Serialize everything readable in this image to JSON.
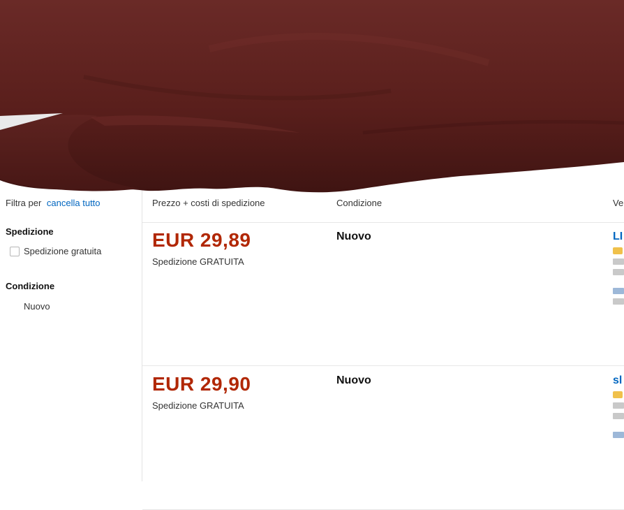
{
  "sidebar": {
    "filter_label": "Filtra per",
    "filter_link": "cancella tutto",
    "facets": [
      {
        "heading": "Spedizione",
        "option": "Spedizione gratuita"
      },
      {
        "heading": "Condizione",
        "option": "Nuovo"
      }
    ]
  },
  "table": {
    "columns": {
      "price": "Prezzo + costi di spedizione",
      "condition": "Condizione",
      "seller": "Ve"
    }
  },
  "offers": [
    {
      "price": "EUR 29,89",
      "shipping": "Spedizione GRATUITA",
      "condition": "Nuovo",
      "seller": "LI"
    },
    {
      "price": "EUR 29,90",
      "shipping": "Spedizione GRATUITA",
      "condition": "Nuovo",
      "seller": "sl"
    }
  ],
  "colors": {
    "price": "#b12704",
    "link": "#0066c0",
    "occluder": "#5a1f1c"
  },
  "icons": [
    "checkbox-icon",
    "star-rating-icon"
  ]
}
